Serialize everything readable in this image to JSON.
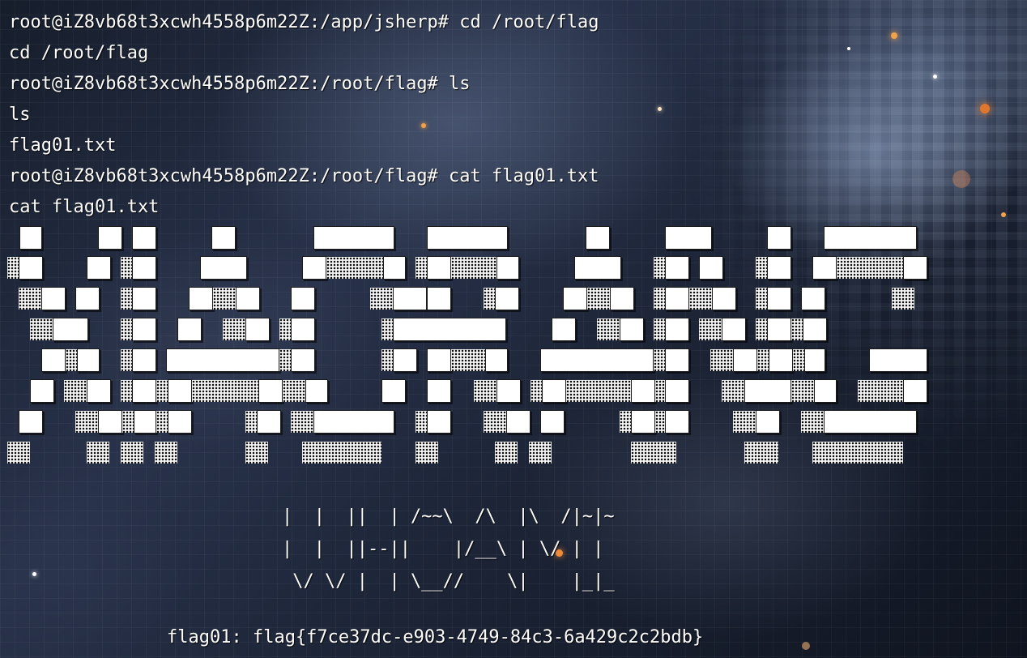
{
  "terminal": {
    "lines": [
      "root@iZ8vb68t3xcwh4558p6m22Z:/app/jsherp# cd /root/flag",
      "cd /root/flag",
      "root@iZ8vb68t3xcwh4558p6m22Z:/root/flag# ls",
      "ls",
      "flag01.txt",
      "root@iZ8vb68t3xcwh4558p6m22Z:/root/flag# cat flag01.txt",
      "cat flag01.txt"
    ],
    "banner_lines": [
      "|  |  ||  | /~~\\  /\\  |\\  /|~|~",
      "|  |  ||--||    |/__\\ | \\/ | |",
      " \\/ \\/ |  | \\__//    \\|    |_|_"
    ],
    "flag_line": "flag01: flag{f7ce37dc-e903-4749-84c3-6a429c2c2bdb}"
  },
  "theme": {
    "text_color": "#ffffff",
    "background_accent": "#28324a",
    "bokeh_orange": "#f2a24a"
  },
  "ascii_art": {
    "style": "block-letter ANSI shadow banner",
    "fill_color": "#ffffff",
    "shade_color": "#101010"
  }
}
